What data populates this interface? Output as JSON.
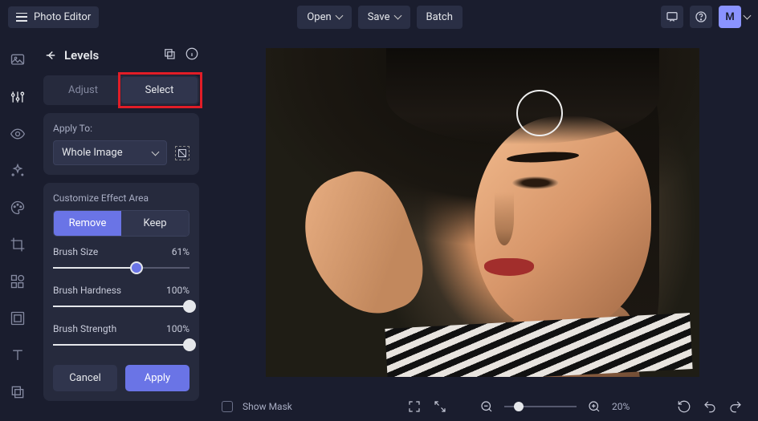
{
  "header": {
    "app_title": "Photo Editor",
    "open_label": "Open",
    "save_label": "Save",
    "batch_label": "Batch",
    "avatar_letter": "M"
  },
  "panel": {
    "title": "Levels",
    "tab_adjust": "Adjust",
    "tab_select": "Select",
    "apply_to_label": "Apply To:",
    "apply_to_value": "Whole Image",
    "customize_label": "Customize Effect Area",
    "remove_label": "Remove",
    "keep_label": "Keep",
    "brush_size_label": "Brush Size",
    "brush_size_value": "61%",
    "brush_size_pct": 61,
    "brush_hardness_label": "Brush Hardness",
    "brush_hardness_value": "100%",
    "brush_hardness_pct": 100,
    "brush_strength_label": "Brush Strength",
    "brush_strength_value": "100%",
    "brush_strength_pct": 100,
    "cancel_label": "Cancel",
    "apply_label": "Apply"
  },
  "bottombar": {
    "show_mask_label": "Show Mask",
    "zoom_value": "20%",
    "zoom_pct": 20
  },
  "icons": {
    "feedback": "feedback-icon",
    "help": "help-icon"
  }
}
